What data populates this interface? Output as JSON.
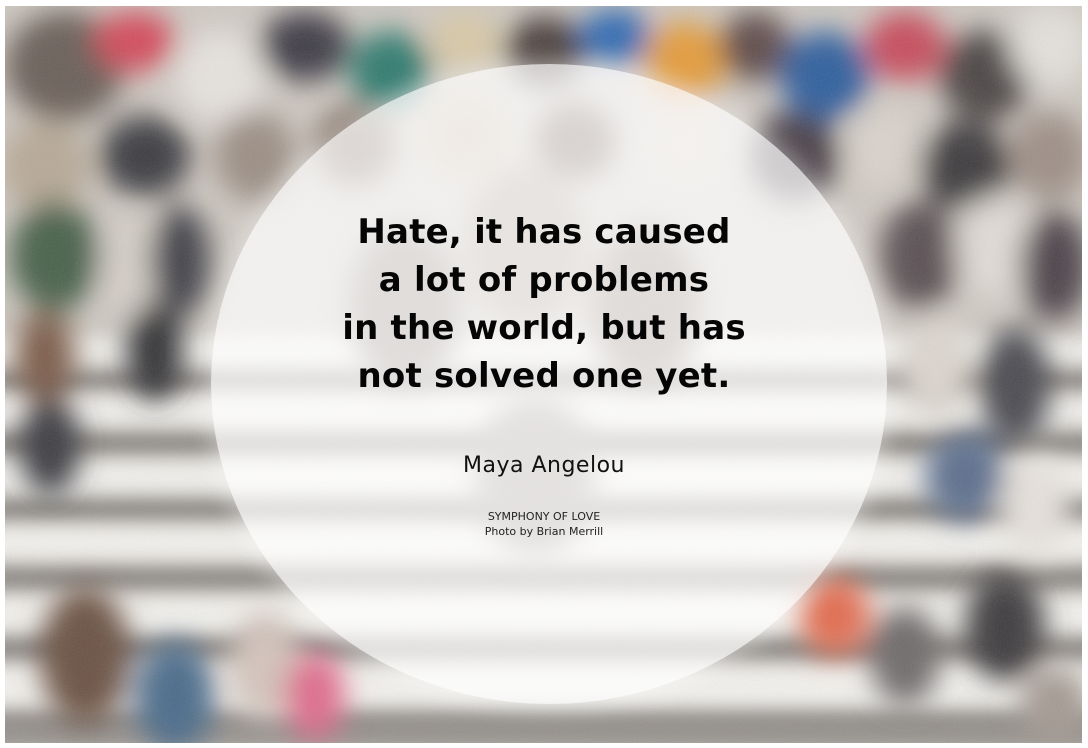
{
  "quote": {
    "lines": [
      "Hate, it has caused",
      "a lot of problems",
      "in the world, but has",
      "not solved one yet."
    ]
  },
  "author": "Maya Angelou",
  "credit": {
    "line1": "SYMPHONY OF LOVE",
    "line2": "Photo by Brian Merrill"
  },
  "colors": {
    "text": "#050505",
    "frame": "#ffffff",
    "circle_overlay": "#ffffff"
  }
}
